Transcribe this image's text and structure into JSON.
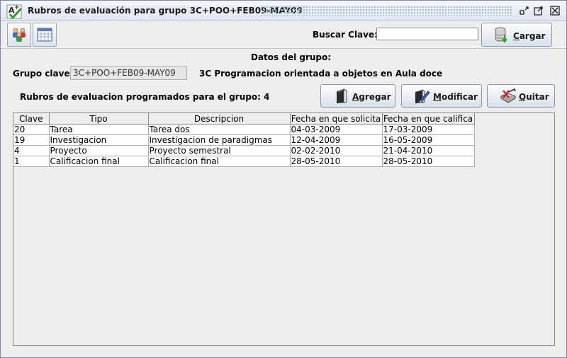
{
  "window": {
    "title": "Rubros de evaluación para grupo 3C+POO+FEB09-MAY09",
    "app_icon": "grade-check-icon",
    "controls": [
      "minimize-icon",
      "maximize-icon",
      "close-icon"
    ]
  },
  "toolbar": {
    "icons": [
      "users-icon",
      "calendar-grid-icon"
    ],
    "search_label": "Buscar Clave:",
    "search_value": "",
    "load_label": "Cargar",
    "load_icon": "database-load-icon"
  },
  "group": {
    "section_title": "Datos del grupo:",
    "key_label": "Grupo clave:",
    "key_value": "3C+POO+FEB09-MAY09",
    "description": "3C Programacion orientada a objetos en Aula doce"
  },
  "rubros": {
    "count_label": "Rubros de evaluacion programados para el grupo: 4",
    "add_label": "Agregar",
    "edit_label": "Modificar",
    "remove_label": "Quitar",
    "columns": [
      "Clave",
      "Tipo",
      "Descripcion",
      "Fecha en que solicita",
      "Fecha en que califica"
    ],
    "rows": [
      [
        "20",
        "Tarea",
        "Tarea dos",
        "04-03-2009",
        "17-03-2009"
      ],
      [
        "19",
        "Investigacion",
        "Investigacion de paradigmas",
        "12-04-2009",
        "16-05-2009"
      ],
      [
        "4",
        "Proyecto",
        "Proyecto semestral",
        "02-02-2010",
        "21-04-2010"
      ],
      [
        "1",
        "Calificacion final",
        "Calificacion final",
        "28-05-2010",
        "28-05-2010"
      ]
    ]
  }
}
